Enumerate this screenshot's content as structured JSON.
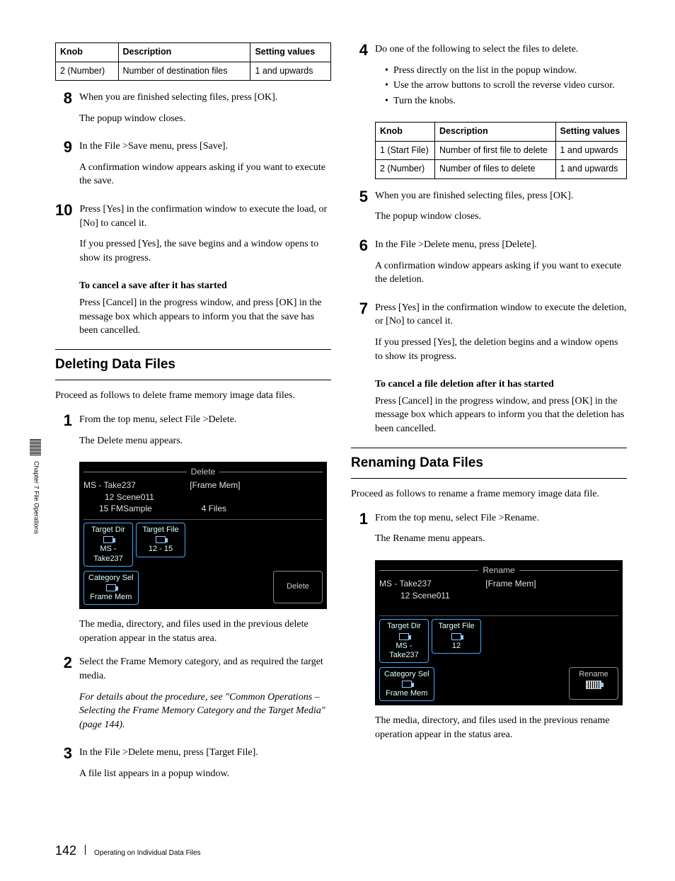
{
  "sideTab": {
    "text": "Chapter 7  File Operations"
  },
  "left": {
    "table1": {
      "headers": [
        "Knob",
        "Description",
        "Setting values"
      ],
      "rows": [
        [
          "2 (Number)",
          "Number of destination files",
          "1 and upwards"
        ]
      ]
    },
    "steps": [
      {
        "n": "8",
        "lines": [
          "When you are finished selecting files, press [OK].",
          "The popup window closes."
        ]
      },
      {
        "n": "9",
        "lines": [
          "In the File >Save menu, press [Save].",
          "A confirmation window appears asking if you want to execute the save."
        ]
      },
      {
        "n": "10",
        "lines": [
          "Press [Yes] in the confirmation window to execute the load, or [No] to cancel it.",
          "If you pressed [Yes], the save begins and a window opens to show its progress."
        ]
      }
    ],
    "cancelSave": {
      "h": "To cancel a save after it has started",
      "p": "Press [Cancel] in the progress window, and press [OK] in the message box which appears to inform you that the save has been cancelled."
    },
    "section": "Deleting Data Files",
    "intro": "Proceed as follows to delete frame memory image data files.",
    "dsteps": {
      "s1": {
        "n": "1",
        "a": "From the top menu, select File >Delete.",
        "b": "The Delete menu appears."
      },
      "s2": {
        "n": "2",
        "a": "Select the Frame Memory category, and as required the target media.",
        "ital": "For details about the procedure, see \"Common Operations – Selecting the Frame Memory Category and the Target Media\" (page 144)."
      },
      "s3": {
        "n": "3",
        "a": "In the File >Delete menu, press [Target File].",
        "b": "A file list appears in a popup window."
      }
    },
    "ui1": {
      "title": "Delete",
      "path": "MS - Take237",
      "mode": "[Frame Mem]",
      "l1a": "12  Scene011",
      "l1b": "15  FMSample",
      "files": "4 Files",
      "btnTargetDir": {
        "t": "Target Dir",
        "sub": "MS -\nTake237"
      },
      "btnTargetFile": {
        "t": "Target File",
        "sub": "12  -   15"
      },
      "btnCat": {
        "t": "Category Sel",
        "sub": "Frame Mem"
      },
      "btnDelete": "Delete"
    },
    "afterUi": "The media, directory, and files used in the previous delete operation appear in the status area."
  },
  "right": {
    "step4": {
      "n": "4",
      "a": "Do one of the following to select the files to delete.",
      "bullets": [
        "Press directly on the list in the popup window.",
        "Use the arrow buttons to scroll the reverse video cursor.",
        "Turn the knobs."
      ]
    },
    "table2": {
      "headers": [
        "Knob",
        "Description",
        "Setting values"
      ],
      "rows": [
        [
          "1 (Start File)",
          "Number of first file to delete",
          "1 and upwards"
        ],
        [
          "2 (Number)",
          "Number of files to delete",
          "1 and upwards"
        ]
      ]
    },
    "step5": {
      "n": "5",
      "a": "When you are finished selecting files, press [OK].",
      "b": "The popup window closes."
    },
    "step6": {
      "n": "6",
      "a": "In the File >Delete menu, press [Delete].",
      "b": "A confirmation window appears asking if you want to execute the deletion."
    },
    "step7": {
      "n": "7",
      "a": "Press [Yes] in the confirmation window to execute the deletion, or [No] to cancel it.",
      "b": "If you pressed [Yes], the deletion begins and a window opens to show its progress."
    },
    "cancelDel": {
      "h": "To cancel a file deletion after it has started",
      "p": "Press [Cancel] in the progress window, and press [OK] in the message box which appears to inform you that the deletion has been cancelled."
    },
    "section": "Renaming Data Files",
    "intro": "Proceed as follows to rename a frame memory image data file.",
    "rstep1": {
      "n": "1",
      "a": "From the top menu, select File >Rename.",
      "b": "The Rename menu appears."
    },
    "ui2": {
      "title": "Rename",
      "path": "MS - Take237",
      "mode": "[Frame Mem]",
      "l1a": "12  Scene011",
      "btnTargetDir": {
        "t": "Target Dir",
        "sub": "MS -\nTake237"
      },
      "btnTargetFile": {
        "t": "Target File",
        "sub": "12"
      },
      "btnCat": {
        "t": "Category Sel",
        "sub": "Frame Mem"
      },
      "btnRename": "Rename"
    },
    "afterUi": "The media, directory, and files used in the previous rename operation appear in the status area."
  },
  "footer": {
    "page": "142",
    "title": "Operating on Individual Data Files"
  }
}
